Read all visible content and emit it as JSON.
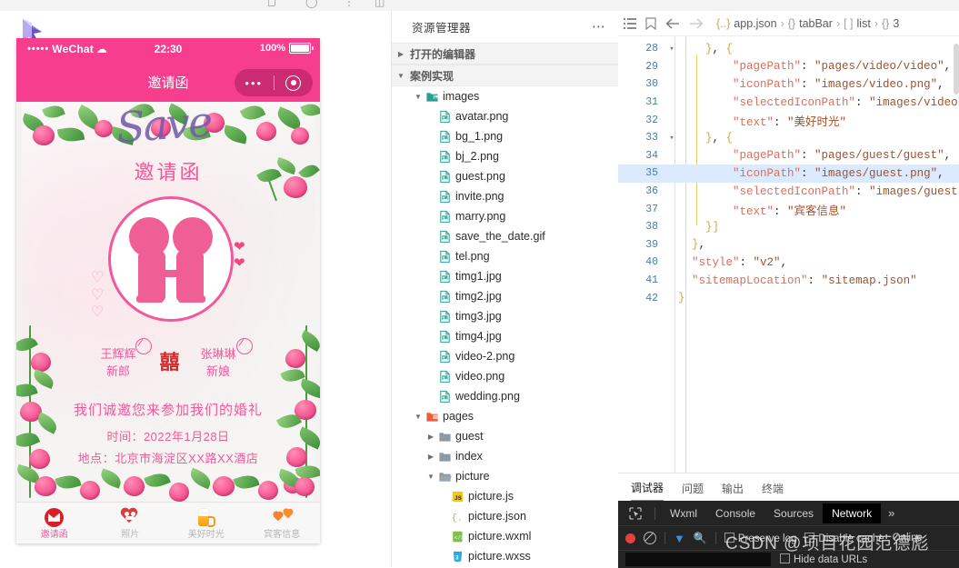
{
  "simulator": {
    "status_bar": {
      "carrier": "WeChat",
      "dots": "•••••",
      "wifi_icon": "wifi-icon",
      "time": "22:30",
      "battery_percent": "100%"
    },
    "nav": {
      "title": "邀请函",
      "capsule_more": "•••",
      "capsule_target_icon": "target-icon"
    },
    "page": {
      "decor_word": "Save",
      "invitation_title": "邀请函",
      "groom": {
        "name": "王辉辉",
        "role": "新郎"
      },
      "bride": {
        "name": "张琳琳",
        "role": "新娘"
      },
      "double_happiness": "囍",
      "main_line": "我们诚邀您来参加我们的婚礼",
      "time_line": "时间：2022年1月28日",
      "place_line": "地点：北京市海淀区XX路XX酒店"
    },
    "tabbar": [
      {
        "label": "邀请函",
        "icon": "envelope-icon",
        "active": true
      },
      {
        "label": "照片",
        "icon": "heart-couple-icon",
        "active": false
      },
      {
        "label": "美好时光",
        "icon": "beer-mug-icon",
        "active": false
      },
      {
        "label": "宾客信息",
        "icon": "two-hearts-icon",
        "active": false
      }
    ]
  },
  "explorer": {
    "title": "资源管理器",
    "more_icon": "ellipsis-icon",
    "sections": [
      {
        "label": "打开的编辑器",
        "expanded": false
      },
      {
        "label": "案例实现",
        "expanded": true
      }
    ],
    "tree": [
      {
        "label": "images",
        "type": "folder-open-images",
        "depth": 1,
        "twisty": "down"
      },
      {
        "label": "avatar.png",
        "type": "image",
        "depth": 2,
        "twisty": ""
      },
      {
        "label": "bg_1.png",
        "type": "image",
        "depth": 2,
        "twisty": ""
      },
      {
        "label": "bj_2.png",
        "type": "image",
        "depth": 2,
        "twisty": ""
      },
      {
        "label": "guest.png",
        "type": "image",
        "depth": 2,
        "twisty": ""
      },
      {
        "label": "invite.png",
        "type": "image",
        "depth": 2,
        "twisty": ""
      },
      {
        "label": "marry.png",
        "type": "image",
        "depth": 2,
        "twisty": ""
      },
      {
        "label": "save_the_date.gif",
        "type": "image",
        "depth": 2,
        "twisty": ""
      },
      {
        "label": "tel.png",
        "type": "image",
        "depth": 2,
        "twisty": ""
      },
      {
        "label": "timg1.jpg",
        "type": "image",
        "depth": 2,
        "twisty": ""
      },
      {
        "label": "timg2.jpg",
        "type": "image",
        "depth": 2,
        "twisty": ""
      },
      {
        "label": "timg3.jpg",
        "type": "image",
        "depth": 2,
        "twisty": ""
      },
      {
        "label": "timg4.jpg",
        "type": "image",
        "depth": 2,
        "twisty": ""
      },
      {
        "label": "video-2.png",
        "type": "image",
        "depth": 2,
        "twisty": ""
      },
      {
        "label": "video.png",
        "type": "image",
        "depth": 2,
        "twisty": ""
      },
      {
        "label": "wedding.png",
        "type": "image",
        "depth": 2,
        "twisty": ""
      },
      {
        "label": "pages",
        "type": "folder-open-pages",
        "depth": 1,
        "twisty": "down"
      },
      {
        "label": "guest",
        "type": "folder",
        "depth": 2,
        "twisty": "right"
      },
      {
        "label": "index",
        "type": "folder",
        "depth": 2,
        "twisty": "right"
      },
      {
        "label": "picture",
        "type": "folder-open",
        "depth": 2,
        "twisty": "down"
      },
      {
        "label": "picture.js",
        "type": "js",
        "depth": 3,
        "twisty": ""
      },
      {
        "label": "picture.json",
        "type": "json",
        "depth": 3,
        "twisty": ""
      },
      {
        "label": "picture.wxml",
        "type": "wxml",
        "depth": 3,
        "twisty": ""
      },
      {
        "label": "picture.wxss",
        "type": "wxss",
        "depth": 3,
        "twisty": ""
      }
    ]
  },
  "editor": {
    "toolbar_icons": [
      "list-icon",
      "bookmark-icon",
      "arrow-left-icon",
      "arrow-right-icon"
    ],
    "breadcrumb": [
      {
        "sym": "{..}",
        "text": "app.json"
      },
      {
        "sym": "{}",
        "text": "tabBar"
      },
      {
        "sym": "[ ]",
        "text": "list"
      },
      {
        "sym": "{}",
        "text": "3"
      }
    ],
    "lines": [
      {
        "n": 28,
        "fold": "down",
        "indent": 2,
        "text": "}, {",
        "hl": false
      },
      {
        "n": 29,
        "fold": "",
        "indent": 4,
        "text": "\"pagePath\": \"pages/video/video\",",
        "hl": false
      },
      {
        "n": 30,
        "fold": "",
        "indent": 4,
        "text": "\"iconPath\": \"images/video.png\",",
        "hl": false
      },
      {
        "n": 31,
        "fold": "",
        "indent": 4,
        "text": "\"selectedIconPath\": \"images/video.png\",",
        "hl": false
      },
      {
        "n": 32,
        "fold": "",
        "indent": 4,
        "text": "\"text\": \"美好时光\"",
        "hl": false
      },
      {
        "n": 33,
        "fold": "down",
        "indent": 2,
        "text": "}, {",
        "hl": false
      },
      {
        "n": 34,
        "fold": "",
        "indent": 4,
        "text": "\"pagePath\": \"pages/guest/guest\",",
        "hl": false
      },
      {
        "n": 35,
        "fold": "",
        "indent": 4,
        "text": "\"iconPath\": \"images/guest.png\",",
        "hl": true
      },
      {
        "n": 36,
        "fold": "",
        "indent": 4,
        "text": "\"selectedIconPath\": \"images/guest.png\",",
        "hl": false
      },
      {
        "n": 37,
        "fold": "",
        "indent": 4,
        "text": "\"text\": \"宾客信息\"",
        "hl": false
      },
      {
        "n": 38,
        "fold": "",
        "indent": 2,
        "text": "}]",
        "hl": false
      },
      {
        "n": 39,
        "fold": "",
        "indent": 1,
        "text": "},",
        "hl": false
      },
      {
        "n": 40,
        "fold": "",
        "indent": 1,
        "text": "\"style\": \"v2\",",
        "hl": false
      },
      {
        "n": 41,
        "fold": "",
        "indent": 1,
        "text": "\"sitemapLocation\": \"sitemap.json\"",
        "hl": false
      },
      {
        "n": 42,
        "fold": "",
        "indent": 0,
        "text": "}",
        "hl": false
      }
    ]
  },
  "panel": {
    "tabs": [
      {
        "label": "调试器",
        "active": true
      },
      {
        "label": "问题",
        "active": false
      },
      {
        "label": "输出",
        "active": false
      },
      {
        "label": "终端",
        "active": false
      }
    ],
    "devtools": {
      "inspect_icon": "inspect-element-icon",
      "tabs": [
        {
          "label": "Wxml",
          "active": false
        },
        {
          "label": "Console",
          "active": false
        },
        {
          "label": "Sources",
          "active": false
        },
        {
          "label": "Network",
          "active": true
        }
      ],
      "more": "»",
      "record_icon": "record-icon",
      "clear_icon": "clear-icon",
      "filter_icon": "filter-icon",
      "search_icon": "search-icon",
      "preserve_log": "Preserve log",
      "disable_cache": "Disable cache",
      "throttle": "Online",
      "watermark": "CSDN @项目花园范德彪"
    }
  },
  "colors": {
    "wechat_pink": "#f73d8e",
    "invite_pink": "#f3589b",
    "accent_red": "#d81f26",
    "devtools_bg": "#242424"
  }
}
